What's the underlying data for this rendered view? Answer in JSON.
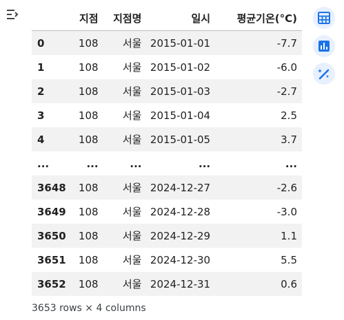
{
  "table": {
    "columns": [
      "",
      "지점",
      "지점명",
      "일시",
      "평균기온(°C)"
    ],
    "rows": [
      [
        "0",
        "108",
        "서울",
        "2015-01-01",
        "-7.7"
      ],
      [
        "1",
        "108",
        "서울",
        "2015-01-02",
        "-6.0"
      ],
      [
        "2",
        "108",
        "서울",
        "2015-01-03",
        "-2.7"
      ],
      [
        "3",
        "108",
        "서울",
        "2015-01-04",
        "2.5"
      ],
      [
        "4",
        "108",
        "서울",
        "2015-01-05",
        "3.7"
      ],
      [
        "...",
        "...",
        "...",
        "...",
        "..."
      ],
      [
        "3648",
        "108",
        "서울",
        "2024-12-27",
        "-2.6"
      ],
      [
        "3649",
        "108",
        "서울",
        "2024-12-28",
        "-3.0"
      ],
      [
        "3650",
        "108",
        "서울",
        "2024-12-29",
        "1.1"
      ],
      [
        "3651",
        "108",
        "서울",
        "2024-12-30",
        "5.5"
      ],
      [
        "3652",
        "108",
        "서울",
        "2024-12-31",
        "0.6"
      ]
    ],
    "summary": "3653 rows × 4 columns"
  },
  "icons": {
    "filter": "filter-list-icon",
    "table": "table-grid-icon",
    "chart": "bar-chart-icon",
    "magic": "magic-wand-icon"
  },
  "colors": {
    "accent": "#1a73e8",
    "button_bg": "#e8f0fe",
    "row_stripe": "#f2f2f2"
  }
}
